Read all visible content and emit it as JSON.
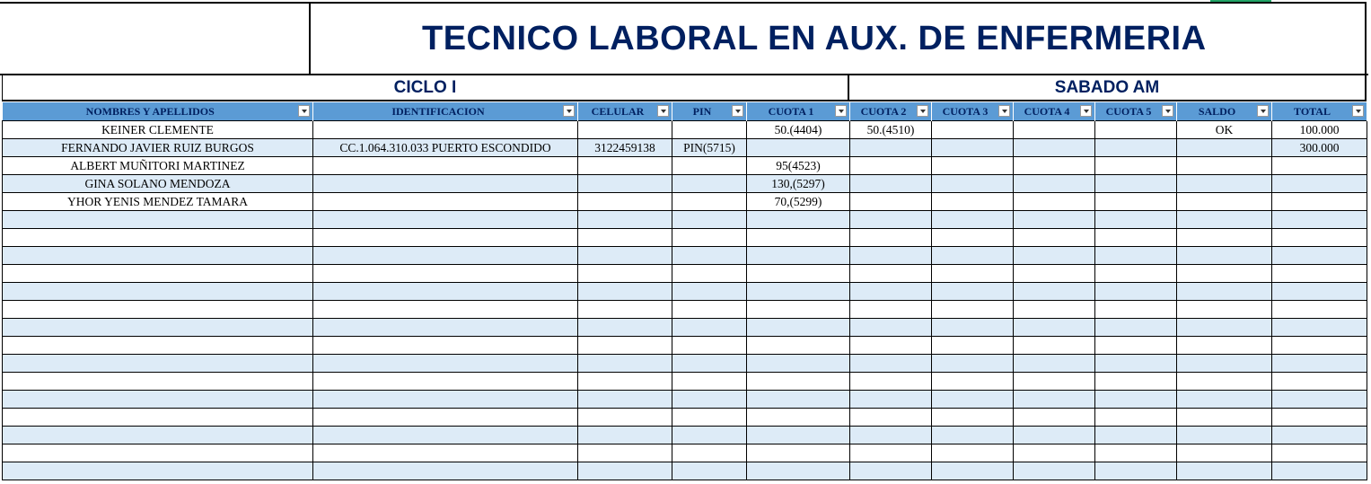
{
  "title": "TECNICO LABORAL EN AUX. DE ENFERMERIA",
  "section_left": "CICLO I",
  "section_right": "SABADO AM",
  "colors": {
    "title": "#002060",
    "header_bg": "#5b9bd5",
    "band": "#ddebf7"
  },
  "columns": [
    "NOMBRES Y APELLIDOS",
    "IDENTIFICACION",
    "CELULAR",
    "PIN",
    "CUOTA 1",
    "CUOTA 2",
    "CUOTA 3",
    "CUOTA 4",
    "CUOTA 5",
    "SALDO",
    "TOTAL"
  ],
  "rows": [
    [
      "KEINER CLEMENTE",
      "",
      "",
      "",
      "50.(4404)",
      "50.(4510)",
      "",
      "",
      "",
      "OK",
      "100.000"
    ],
    [
      "FERNANDO JAVIER RUIZ BURGOS",
      "CC.1.064.310.033 PUERTO ESCONDIDO",
      "3122459138",
      "PIN(5715)",
      "",
      "",
      "",
      "",
      "",
      "",
      "300.000"
    ],
    [
      "ALBERT MUÑITORI MARTINEZ",
      "",
      "",
      "",
      "95(4523)",
      "",
      "",
      "",
      "",
      "",
      ""
    ],
    [
      "GINA SOLANO MENDOZA",
      "",
      "",
      "",
      "130,(5297)",
      "",
      "",
      "",
      "",
      "",
      ""
    ],
    [
      "YHOR YENIS MENDEZ TAMARA",
      "",
      "",
      "",
      "70,(5299)",
      "",
      "",
      "",
      "",
      "",
      ""
    ],
    [
      "",
      "",
      "",
      "",
      "",
      "",
      "",
      "",
      "",
      "",
      ""
    ],
    [
      "",
      "",
      "",
      "",
      "",
      "",
      "",
      "",
      "",
      "",
      ""
    ],
    [
      "",
      "",
      "",
      "",
      "",
      "",
      "",
      "",
      "",
      "",
      ""
    ],
    [
      "",
      "",
      "",
      "",
      "",
      "",
      "",
      "",
      "",
      "",
      ""
    ],
    [
      "",
      "",
      "",
      "",
      "",
      "",
      "",
      "",
      "",
      "",
      ""
    ],
    [
      "",
      "",
      "",
      "",
      "",
      "",
      "",
      "",
      "",
      "",
      ""
    ],
    [
      "",
      "",
      "",
      "",
      "",
      "",
      "",
      "",
      "",
      "",
      ""
    ],
    [
      "",
      "",
      "",
      "",
      "",
      "",
      "",
      "",
      "",
      "",
      ""
    ],
    [
      "",
      "",
      "",
      "",
      "",
      "",
      "",
      "",
      "",
      "",
      ""
    ],
    [
      "",
      "",
      "",
      "",
      "",
      "",
      "",
      "",
      "",
      "",
      ""
    ],
    [
      "",
      "",
      "",
      "",
      "",
      "",
      "",
      "",
      "",
      "",
      ""
    ],
    [
      "",
      "",
      "",
      "",
      "",
      "",
      "",
      "",
      "",
      "",
      ""
    ],
    [
      "",
      "",
      "",
      "",
      "",
      "",
      "",
      "",
      "",
      "",
      ""
    ],
    [
      "",
      "",
      "",
      "",
      "",
      "",
      "",
      "",
      "",
      "",
      ""
    ],
    [
      "",
      "",
      "",
      "",
      "",
      "",
      "",
      "",
      "",
      "",
      ""
    ]
  ]
}
